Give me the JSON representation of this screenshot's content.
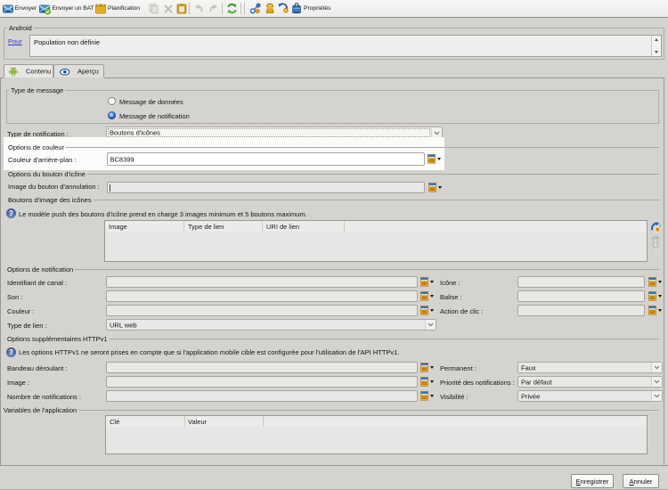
{
  "toolbar": {
    "send": "Envoyer",
    "send_proof": "Envoyer un BAT",
    "schedule": "Planification",
    "properties": "Propriétés"
  },
  "android_box": {
    "legend": "Android",
    "to_link": "Pour",
    "target_value": "Population non définie"
  },
  "tabs": [
    {
      "label": "Contenu",
      "active": true
    },
    {
      "label": "Aperçu",
      "active": false
    }
  ],
  "message_type": {
    "legend": "Type de message",
    "radio_data": "Message de données",
    "radio_notification": "Message de notification"
  },
  "notification_type": {
    "label": "Type de notification :",
    "value": "Boutons d'icônes"
  },
  "color_options": {
    "section": "Options de couleur",
    "background_label": "Couleur d'arrière-plan :",
    "background_value": "BC8399"
  },
  "icon_button_options": {
    "section": "Options du bouton d'icône",
    "cancel_image_label": "Image du bouton d'annulation :",
    "cancel_image_value": ""
  },
  "icon_images": {
    "section": "Boutons d'image des icônes",
    "info": "Le modèle push des boutons d'icône prend en charge 3 images minimum et 5 boutons maximum.",
    "columns": [
      "Image",
      "Type de lien",
      "URI de lien"
    ]
  },
  "notification_options": {
    "section": "Options de notification",
    "left": [
      {
        "label": "Identifiant de canal :",
        "value": ""
      },
      {
        "label": "Son :",
        "value": ""
      },
      {
        "label": "Couleur :",
        "value": ""
      },
      {
        "label": "Type de lien :",
        "value": "URL web"
      }
    ],
    "right": [
      {
        "label": "Icône :",
        "value": ""
      },
      {
        "label": "Balise :",
        "value": ""
      },
      {
        "label": "Action de clic :",
        "value": ""
      }
    ]
  },
  "httpv1_options": {
    "section": "Options supplémentaires HTTPv1",
    "info": "Les options HTTPv1 ne seront prises en compte que si l'application mobile cible est configurée pour l'utilisation de l'API HTTPv1.",
    "left": [
      {
        "label": "Bandeau déroulant :",
        "value": ""
      },
      {
        "label": "Image :",
        "value": ""
      },
      {
        "label": "Nombre de notifications :",
        "value": ""
      }
    ],
    "right": [
      {
        "label": "Permanent :",
        "value": "Faux"
      },
      {
        "label": "Priorité des notifications :",
        "value": "Par défaut"
      },
      {
        "label": "Visibilité :",
        "value": "Privée"
      }
    ]
  },
  "app_variables": {
    "section": "Variables de l'application",
    "columns": [
      "Clé",
      "Valeur"
    ]
  },
  "footer": {
    "save": "Enregistrer",
    "cancel": "Annuler"
  }
}
